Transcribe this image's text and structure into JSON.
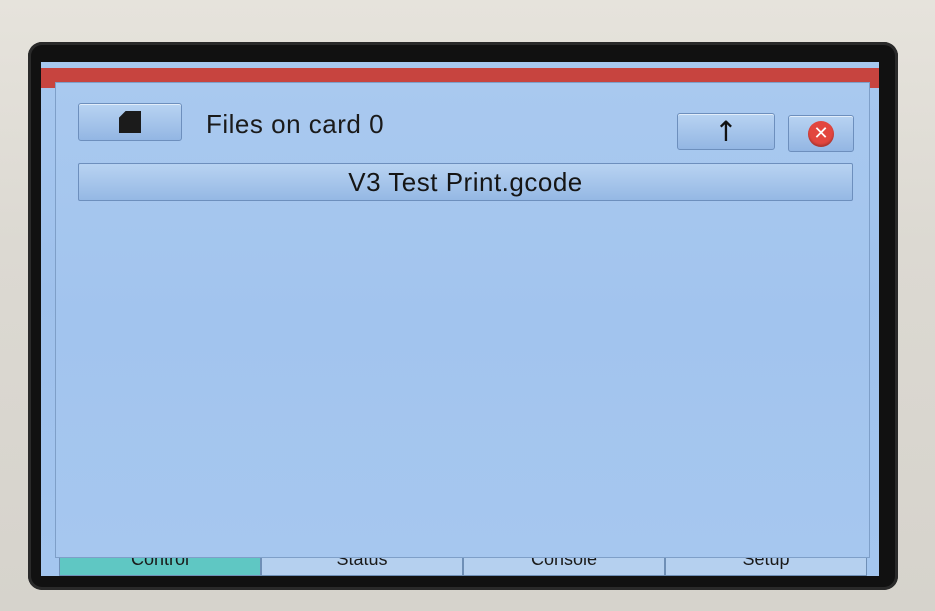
{
  "background_ui": {
    "tabs": [
      {
        "label": "Control",
        "active": true
      },
      {
        "label": "Status",
        "active": false
      },
      {
        "label": "Console",
        "active": false
      },
      {
        "label": "Setup",
        "active": false
      }
    ]
  },
  "dialog": {
    "sd_button_icon": "sd-card-icon",
    "title": "Files on card 0",
    "up_button_icon": "up-arrow-icon",
    "up_button_label": "↑",
    "close_button_icon": "close-icon",
    "close_button_label": "✕",
    "files": [
      {
        "name": "V3 Test Print.gcode"
      }
    ]
  },
  "colors": {
    "screen_blue": "#a4c6ef",
    "accent_red": "#e2463f",
    "title_strip": "#c7443f",
    "active_tab": "#5fc7c3"
  }
}
